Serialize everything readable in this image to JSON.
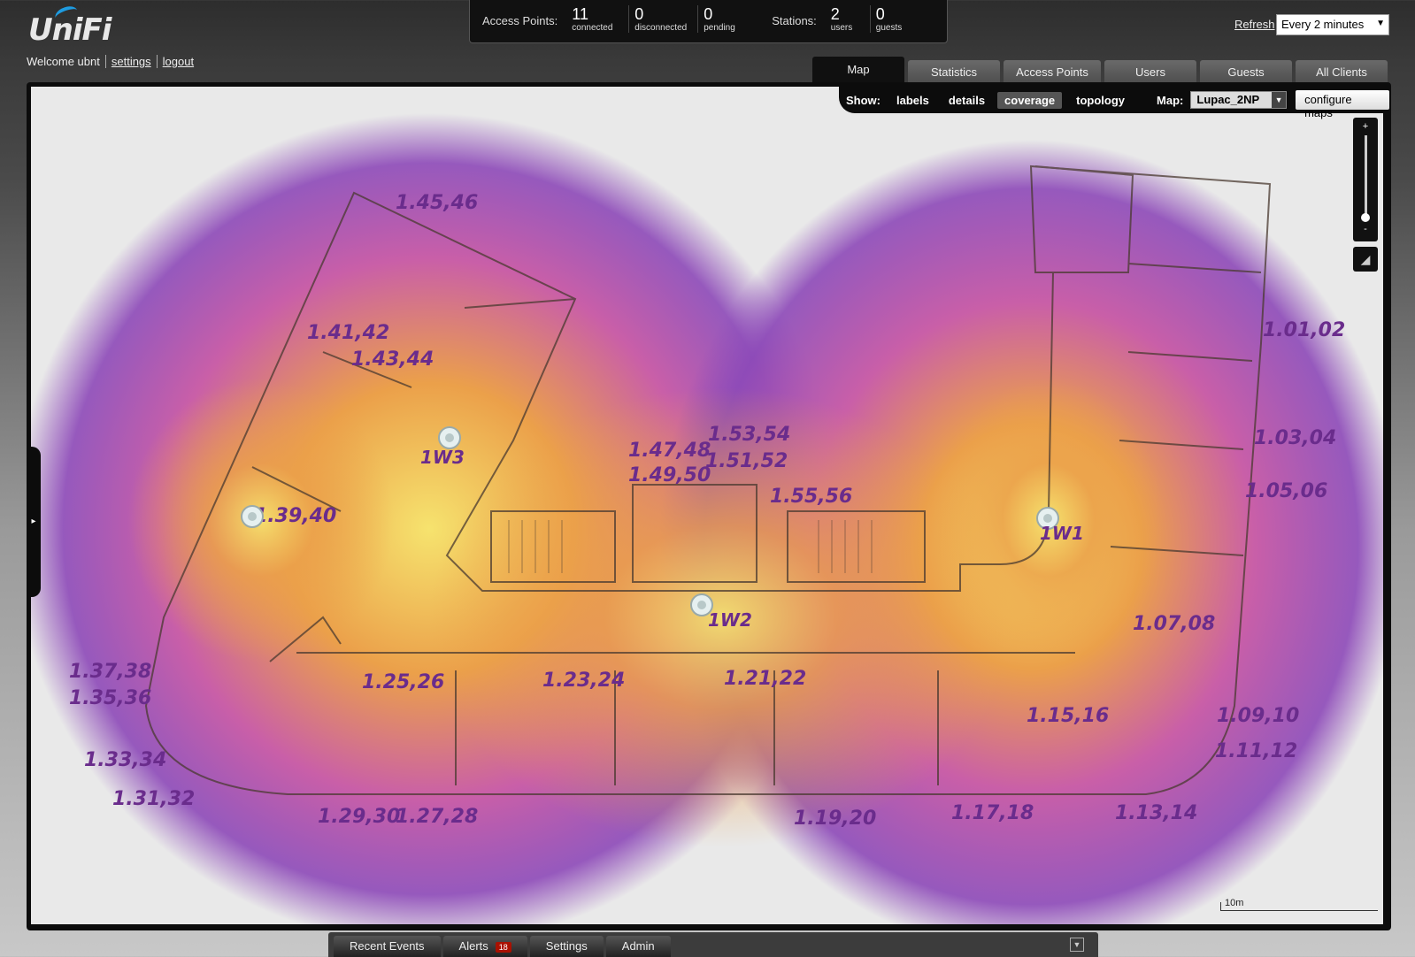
{
  "brand": {
    "logo": "UniFi"
  },
  "user": {
    "welcome": "Welcome ubnt",
    "settings_link": "settings",
    "logout_link": "logout"
  },
  "stats": {
    "access_points_label": "Access Points:",
    "connected": "11",
    "connected_cap": "connected",
    "disconnected": "0",
    "disconnected_cap": "disconnected",
    "pending": "0",
    "pending_cap": "pending",
    "stations_label": "Stations:",
    "users": "2",
    "users_cap": "users",
    "guests": "0",
    "guests_cap": "guests"
  },
  "refresh": {
    "label": "Refresh",
    "value": "Every 2 minutes"
  },
  "tabs": [
    "Map",
    "Statistics",
    "Access Points",
    "Users",
    "Guests",
    "All Clients"
  ],
  "toolbar": {
    "show_label": "Show:",
    "options": [
      "labels",
      "details",
      "coverage",
      "topology"
    ],
    "active_option": "coverage",
    "map_label": "Map:",
    "map_value": "Lupac_2NP",
    "configure": "configure maps"
  },
  "zoom": {
    "plus": "+",
    "minus": "-"
  },
  "scale_label": "10m",
  "map_labels": {
    "a": "1.45,46",
    "b": "1.41,42",
    "c": "1.43,44",
    "d": "1.39,40",
    "e": "1.47,48",
    "f": "1.49,50",
    "g": "1.53,54",
    "h": "1.51,52",
    "i": "1.55,56",
    "j": "1.01,02",
    "k": "1.03,04",
    "l": "1.05,06",
    "m": "1.07,08",
    "n": "1.09,10",
    "o": "1.11,12",
    "p": "1.37,38",
    "q": "1.35,36",
    "r": "1.33,34",
    "s": "1.31,32",
    "t": "1.29,30",
    "u": "1.27,28",
    "v": "1.25,26",
    "w": "1.23,24",
    "x": "1.21,22",
    "y": "1.19,20",
    "z": "1.17,18",
    "aa": "1.15,16",
    "ab": "1.13,14"
  },
  "access_points": {
    "ap1": "1W1",
    "ap2": "1W2",
    "ap3": "1W3"
  },
  "bottom_tabs": {
    "events": "Recent Events",
    "alerts": "Alerts",
    "alerts_count": "18",
    "settings": "Settings",
    "admin": "Admin"
  },
  "colors": {
    "accent": "#1e9be0",
    "heat_hot": "#f4e06a",
    "heat_mid": "#e08a3c",
    "heat_cool": "#b24bc0",
    "heat_edge": "#7d3fb0",
    "label_ink": "#6a2c8c"
  }
}
